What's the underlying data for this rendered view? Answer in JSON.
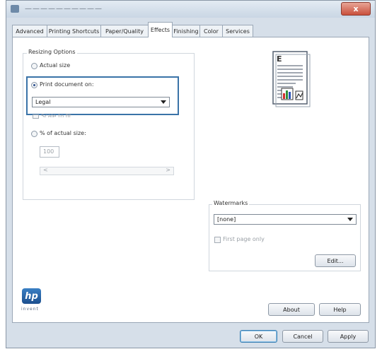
{
  "window": {
    "title": "——————————",
    "close_label": "x"
  },
  "tabs": [
    {
      "label": "Advanced"
    },
    {
      "label": "Printing Shortcuts"
    },
    {
      "label": "Paper/Quality"
    },
    {
      "label": "Effects"
    },
    {
      "label": "Finishing"
    },
    {
      "label": "Color"
    },
    {
      "label": "Services"
    }
  ],
  "resizing": {
    "legend": "Resizing Options",
    "actual_size_label": "Actual size",
    "print_on_label": "Print document on:",
    "paper_value": "Legal",
    "scale_label": "Scale to fit",
    "percent_label": "% of actual size:",
    "percent_value": "100",
    "slider_left": "<",
    "slider_right": ">"
  },
  "watermarks": {
    "legend": "Watermarks",
    "value": "[none]",
    "first_page_label": "First page only",
    "edit_label": "Edit..."
  },
  "buttons": {
    "about": "About",
    "help": "Help",
    "ok": "OK",
    "cancel": "Cancel",
    "apply": "Apply"
  },
  "brand": {
    "logo_text": "hp",
    "caption": "invent"
  },
  "colors": {
    "accent": "#3a73a8",
    "close": "#c9503c"
  }
}
